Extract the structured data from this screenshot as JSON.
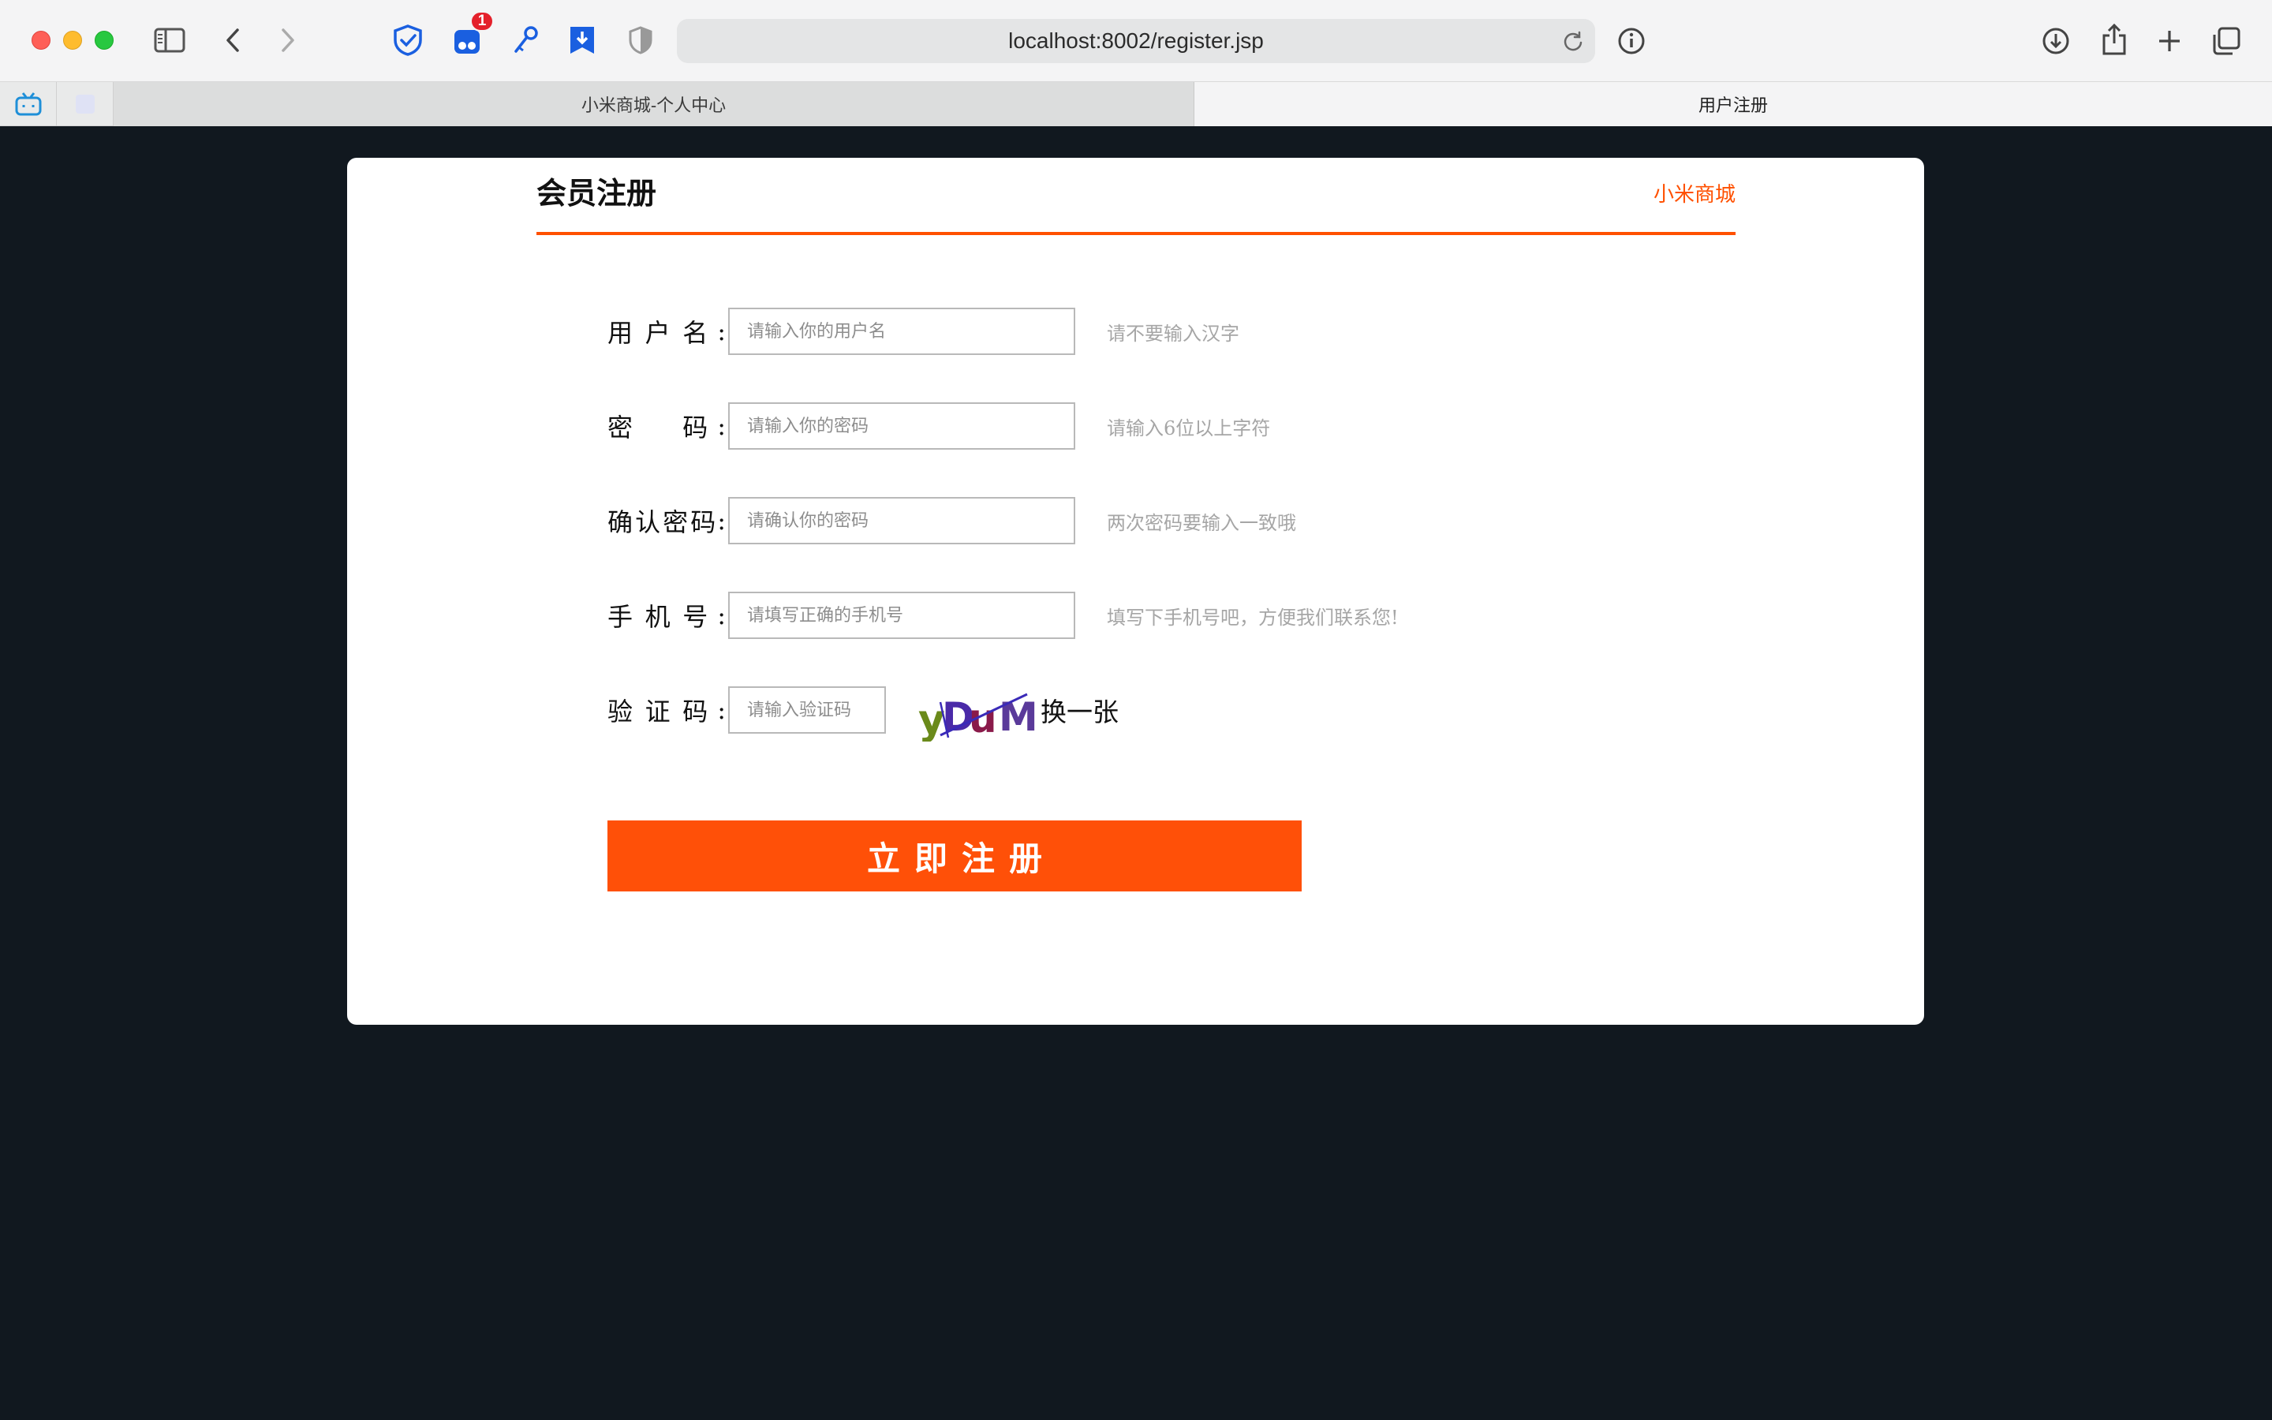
{
  "browser": {
    "url": "localhost:8002/register.jsp",
    "extension_badge": "1",
    "tabs": [
      {
        "title": "小米商城-个人中心",
        "active": false
      },
      {
        "title": "用户注册",
        "active": true
      }
    ],
    "icons": [
      "sidebar-icon",
      "back-icon",
      "forward-icon",
      "shield-check-icon",
      "tab-manager-icon",
      "key-icon",
      "bookmark-download-icon",
      "half-shield-icon",
      "reload-icon",
      "info-icon",
      "download-icon",
      "share-icon",
      "new-tab-icon",
      "tab-overview-icon"
    ]
  },
  "page": {
    "title": "会员注册",
    "brand_link": "小米商城",
    "accent_color": "#ff5000",
    "fields": [
      {
        "label_chars": [
          "用",
          "户",
          "名"
        ],
        "colon": ":",
        "placeholder": "请输入你的用户名",
        "hint": "请不要输入汉字"
      },
      {
        "label_chars": [
          "密",
          "码"
        ],
        "colon": ":",
        "placeholder": "请输入你的密码",
        "hint": "请输入6位以上字符"
      },
      {
        "label_chars": [
          "确",
          "认",
          "密",
          "码"
        ],
        "colon": ":",
        "placeholder": "请确认你的密码",
        "hint": "两次密码要输入一致哦"
      },
      {
        "label_chars": [
          "手",
          "机",
          "号"
        ],
        "colon": ":",
        "placeholder": "请填写正确的手机号",
        "hint": "填写下手机号吧，方便我们联系您!"
      }
    ],
    "captcha": {
      "label_chars": [
        "验",
        "证",
        "码"
      ],
      "colon": ":",
      "placeholder": "请输入验证码",
      "image_text": "yDuM",
      "refresh_label": "换一张"
    },
    "submit_label": "立即注册"
  }
}
